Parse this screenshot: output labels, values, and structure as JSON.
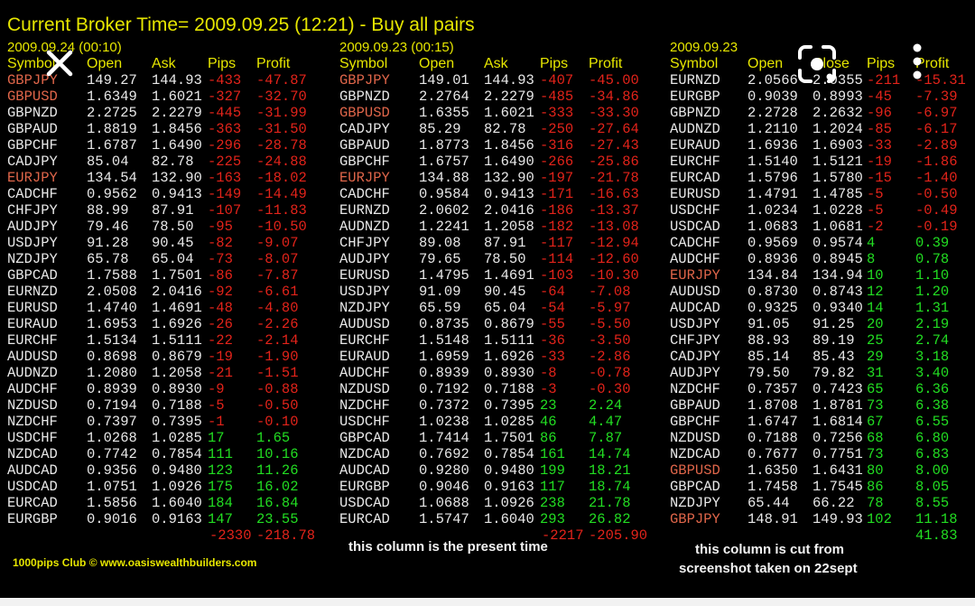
{
  "title": "Current Broker Time= 2009.09.25 (12:21) - Buy all pairs",
  "columns": [
    {
      "date": "2009.09.24 (00:10)",
      "headers": [
        "Symbol",
        "Open",
        "Ask",
        "Pips",
        "Profit"
      ],
      "rows": [
        [
          "GBPJPY",
          "149.27",
          "144.93",
          "-433",
          "-47.87",
          1
        ],
        [
          "GBPUSD",
          "1.6349",
          "1.6021",
          "-327",
          "-32.70",
          1
        ],
        [
          "GBPNZD",
          "2.2725",
          "2.2279",
          "-445",
          "-31.99",
          0
        ],
        [
          "GBPAUD",
          "1.8819",
          "1.8456",
          "-363",
          "-31.50",
          0
        ],
        [
          "GBPCHF",
          "1.6787",
          "1.6490",
          "-296",
          "-28.78",
          0
        ],
        [
          "CADJPY",
          "85.04",
          "82.78",
          "-225",
          "-24.88",
          0
        ],
        [
          "EURJPY",
          "134.54",
          "132.90",
          "-163",
          "-18.02",
          1
        ],
        [
          "CADCHF",
          "0.9562",
          "0.9413",
          "-149",
          "-14.49",
          0
        ],
        [
          "CHFJPY",
          "88.99",
          "87.91",
          "-107",
          "-11.83",
          0
        ],
        [
          "AUDJPY",
          "79.46",
          "78.50",
          "-95",
          "-10.50",
          0
        ],
        [
          "USDJPY",
          "91.28",
          "90.45",
          "-82",
          "-9.07",
          0
        ],
        [
          "NZDJPY",
          "65.78",
          "65.04",
          "-73",
          "-8.07",
          0
        ],
        [
          "GBPCAD",
          "1.7588",
          "1.7501",
          "-86",
          "-7.87",
          0
        ],
        [
          "EURNZD",
          "2.0508",
          "2.0416",
          "-92",
          "-6.61",
          0
        ],
        [
          "EURUSD",
          "1.4740",
          "1.4691",
          "-48",
          "-4.80",
          0
        ],
        [
          "EURAUD",
          "1.6953",
          "1.6926",
          "-26",
          "-2.26",
          0
        ],
        [
          "EURCHF",
          "1.5134",
          "1.5111",
          "-22",
          "-2.14",
          0
        ],
        [
          "AUDUSD",
          "0.8698",
          "0.8679",
          "-19",
          "-1.90",
          0
        ],
        [
          "AUDNZD",
          "1.2080",
          "1.2058",
          "-21",
          "-1.51",
          0
        ],
        [
          "AUDCHF",
          "0.8939",
          "0.8930",
          "-9",
          "-0.88",
          0
        ],
        [
          "NZDUSD",
          "0.7194",
          "0.7188",
          "-5",
          "-0.50",
          0
        ],
        [
          "NZDCHF",
          "0.7397",
          "0.7395",
          "-1",
          "-0.10",
          0
        ],
        [
          "USDCHF",
          "1.0268",
          "1.0285",
          "17",
          "1.65",
          0
        ],
        [
          "NZDCAD",
          "0.7742",
          "0.7854",
          "111",
          "10.16",
          0
        ],
        [
          "AUDCAD",
          "0.9356",
          "0.9480",
          "123",
          "11.26",
          0
        ],
        [
          "USDCAD",
          "1.0751",
          "1.0926",
          "175",
          "16.02",
          0
        ],
        [
          "EURCAD",
          "1.5856",
          "1.6040",
          "184",
          "16.84",
          0
        ],
        [
          "EURGBP",
          "0.9016",
          "0.9163",
          "147",
          "23.55",
          0
        ]
      ],
      "total_pips": "-2330",
      "total_profit": "-218.78"
    },
    {
      "date": "2009.09.23 (00:15)",
      "headers": [
        "Symbol",
        "Open",
        "Ask",
        "Pips",
        "Profit"
      ],
      "rows": [
        [
          "GBPJPY",
          "149.01",
          "144.93",
          "-407",
          "-45.00",
          1
        ],
        [
          "GBPNZD",
          "2.2764",
          "2.2279",
          "-485",
          "-34.86",
          0
        ],
        [
          "GBPUSD",
          "1.6355",
          "1.6021",
          "-333",
          "-33.30",
          1
        ],
        [
          "CADJPY",
          "85.29",
          "82.78",
          "-250",
          "-27.64",
          0
        ],
        [
          "GBPAUD",
          "1.8773",
          "1.8456",
          "-316",
          "-27.43",
          0
        ],
        [
          "GBPCHF",
          "1.6757",
          "1.6490",
          "-266",
          "-25.86",
          0
        ],
        [
          "EURJPY",
          "134.88",
          "132.90",
          "-197",
          "-21.78",
          1
        ],
        [
          "CADCHF",
          "0.9584",
          "0.9413",
          "-171",
          "-16.63",
          0
        ],
        [
          "EURNZD",
          "2.0602",
          "2.0416",
          "-186",
          "-13.37",
          0
        ],
        [
          "AUDNZD",
          "1.2241",
          "1.2058",
          "-182",
          "-13.08",
          0
        ],
        [
          "CHFJPY",
          "89.08",
          "87.91",
          "-117",
          "-12.94",
          0
        ],
        [
          "AUDJPY",
          "79.65",
          "78.50",
          "-114",
          "-12.60",
          0
        ],
        [
          "EURUSD",
          "1.4795",
          "1.4691",
          "-103",
          "-10.30",
          0
        ],
        [
          "USDJPY",
          "91.09",
          "90.45",
          "-64",
          "-7.08",
          0
        ],
        [
          "NZDJPY",
          "65.59",
          "65.04",
          "-54",
          "-5.97",
          0
        ],
        [
          "AUDUSD",
          "0.8735",
          "0.8679",
          "-55",
          "-5.50",
          0
        ],
        [
          "EURCHF",
          "1.5148",
          "1.5111",
          "-36",
          "-3.50",
          0
        ],
        [
          "EURAUD",
          "1.6959",
          "1.6926",
          "-33",
          "-2.86",
          0
        ],
        [
          "AUDCHF",
          "0.8939",
          "0.8930",
          "-8",
          "-0.78",
          0
        ],
        [
          "NZDUSD",
          "0.7192",
          "0.7188",
          "-3",
          "-0.30",
          0
        ],
        [
          "NZDCHF",
          "0.7372",
          "0.7395",
          "23",
          "2.24",
          0
        ],
        [
          "USDCHF",
          "1.0238",
          "1.0285",
          "46",
          "4.47",
          0
        ],
        [
          "GBPCAD",
          "1.7414",
          "1.7501",
          "86",
          "7.87",
          0
        ],
        [
          "NZDCAD",
          "0.7692",
          "0.7854",
          "161",
          "14.74",
          0
        ],
        [
          "AUDCAD",
          "0.9280",
          "0.9480",
          "199",
          "18.21",
          0
        ],
        [
          "EURGBP",
          "0.9046",
          "0.9163",
          "117",
          "18.74",
          0
        ],
        [
          "USDCAD",
          "1.0688",
          "1.0926",
          "238",
          "21.78",
          0
        ],
        [
          "EURCAD",
          "1.5747",
          "1.6040",
          "293",
          "26.82",
          0
        ]
      ],
      "total_pips": "-2217",
      "total_profit": "-205.90"
    },
    {
      "date": "2009.09.23",
      "headers": [
        "Symbol",
        "Open",
        "Close",
        "Pips",
        "Profit"
      ],
      "rows": [
        [
          "EURNZD",
          "2.0566",
          "2.0355",
          "-211",
          "-15.31",
          0
        ],
        [
          "EURGBP",
          "0.9039",
          "0.8993",
          "-45",
          "-7.39",
          0
        ],
        [
          "GBPNZD",
          "2.2728",
          "2.2632",
          "-96",
          "-6.97",
          0
        ],
        [
          "AUDNZD",
          "1.2110",
          "1.2024",
          "-85",
          "-6.17",
          0
        ],
        [
          "EURAUD",
          "1.6936",
          "1.6903",
          "-33",
          "-2.89",
          0
        ],
        [
          "EURCHF",
          "1.5140",
          "1.5121",
          "-19",
          "-1.86",
          0
        ],
        [
          "EURCAD",
          "1.5796",
          "1.5780",
          "-15",
          "-1.40",
          0
        ],
        [
          "EURUSD",
          "1.4791",
          "1.4785",
          "-5",
          "-0.50",
          0
        ],
        [
          "USDCHF",
          "1.0234",
          "1.0228",
          "-5",
          "-0.49",
          0
        ],
        [
          "USDCAD",
          "1.0683",
          "1.0681",
          "-2",
          "-0.19",
          0
        ],
        [
          "CADCHF",
          "0.9569",
          "0.9574",
          "4",
          "0.39",
          0
        ],
        [
          "AUDCHF",
          "0.8936",
          "0.8945",
          "8",
          "0.78",
          0
        ],
        [
          "EURJPY",
          "134.84",
          "134.94",
          "10",
          "1.10",
          1
        ],
        [
          "AUDUSD",
          "0.8730",
          "0.8743",
          "12",
          "1.20",
          0
        ],
        [
          "AUDCAD",
          "0.9325",
          "0.9340",
          "14",
          "1.31",
          0
        ],
        [
          "USDJPY",
          "91.05",
          "91.25",
          "20",
          "2.19",
          0
        ],
        [
          "CHFJPY",
          "88.93",
          "89.19",
          "25",
          "2.74",
          0
        ],
        [
          "CADJPY",
          "85.14",
          "85.43",
          "29",
          "3.18",
          0
        ],
        [
          "AUDJPY",
          "79.50",
          "79.82",
          "31",
          "3.40",
          0
        ],
        [
          "NZDCHF",
          "0.7357",
          "0.7423",
          "65",
          "6.36",
          0
        ],
        [
          "GBPAUD",
          "1.8708",
          "1.8781",
          "73",
          "6.38",
          0
        ],
        [
          "GBPCHF",
          "1.6747",
          "1.6814",
          "67",
          "6.55",
          0
        ],
        [
          "NZDUSD",
          "0.7188",
          "0.7256",
          "68",
          "6.80",
          0
        ],
        [
          "NZDCAD",
          "0.7677",
          "0.7751",
          "73",
          "6.83",
          0
        ],
        [
          "GBPUSD",
          "1.6350",
          "1.6431",
          "80",
          "8.00",
          1
        ],
        [
          "GBPCAD",
          "1.7458",
          "1.7545",
          "86",
          "8.05",
          0
        ],
        [
          "NZDJPY",
          "65.44",
          "66.22",
          "78",
          "8.55",
          0
        ],
        [
          "GBPJPY",
          "148.91",
          "149.93",
          "102",
          "11.18",
          1
        ]
      ],
      "total_pips": "",
      "total_profit": "41.83"
    }
  ],
  "notes": {
    "present": "this column is the present time",
    "cut_line1": "this column is cut from",
    "cut_line2": "screenshot taken on 22sept"
  },
  "footer": "1000pips Club © www.oasiswealthbuilders.com",
  "icons": {
    "close": "close-icon",
    "lens": "lens-scan-icon",
    "more": "more-vertical-icon"
  },
  "colors": {
    "title": "#e6e600",
    "negative": "#e2231a",
    "positive": "#22dd22",
    "highlight_symbol": "#e0664a"
  }
}
